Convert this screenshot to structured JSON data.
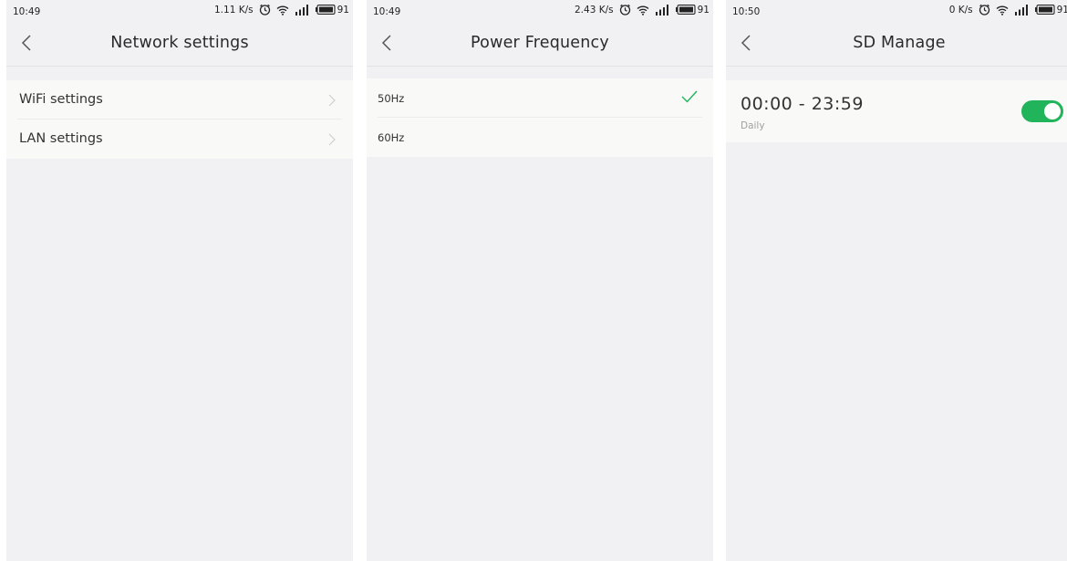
{
  "colors": {
    "accent": "#22b45a",
    "background": "#f1f1f3",
    "card": "#f9f9f8"
  },
  "screens": [
    {
      "status": {
        "time": "10:49",
        "speed": "1.11 K/s",
        "battery": "91"
      },
      "title": "Network settings",
      "items": [
        {
          "label": "WiFi settings",
          "icon": "chevron-right-icon"
        },
        {
          "label": "LAN settings",
          "icon": "chevron-right-icon"
        }
      ]
    },
    {
      "status": {
        "time": "10:49",
        "speed": "2.43 K/s",
        "battery": "91"
      },
      "title": "Power Frequency",
      "options": [
        {
          "label": "50Hz",
          "selected": true
        },
        {
          "label": "60Hz",
          "selected": false
        }
      ]
    },
    {
      "status": {
        "time": "10:50",
        "speed": "0 K/s",
        "battery": "91"
      },
      "title": "SD Manage",
      "schedule": {
        "range": "00:00 - 23:59",
        "repeat": "Daily",
        "enabled": true
      }
    }
  ]
}
